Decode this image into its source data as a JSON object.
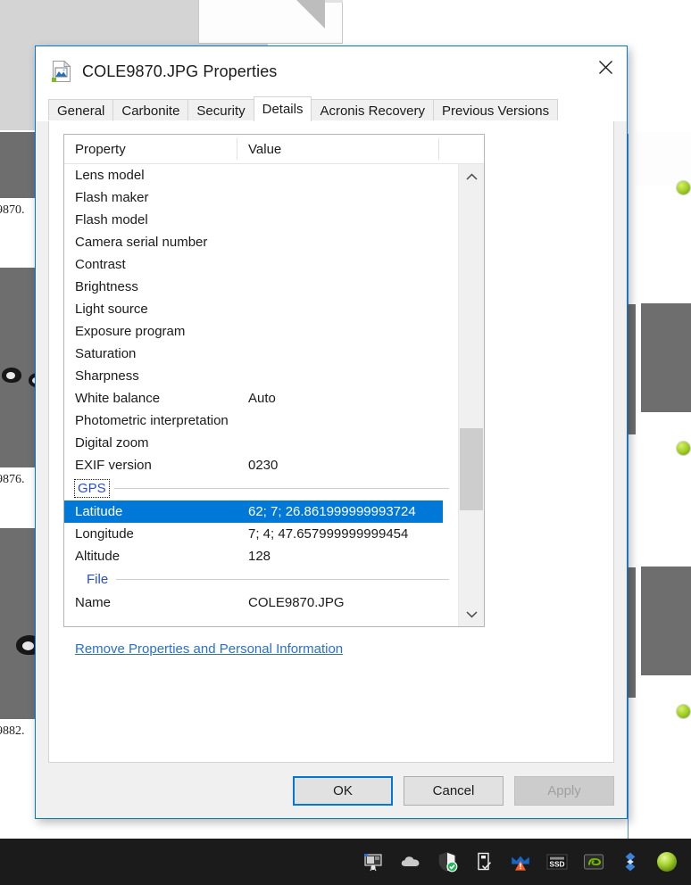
{
  "dialog": {
    "title": "COLE9870.JPG Properties",
    "title_icon": "image-file-icon",
    "close_icon": "close-icon",
    "accent_color": "#0078D7",
    "selection_color": "#0078D7",
    "link_color": "#2A6FD4",
    "section_color": "#2A4FC4"
  },
  "tabs": [
    {
      "label": "General",
      "active": false
    },
    {
      "label": "Carbonite",
      "active": false
    },
    {
      "label": "Security",
      "active": false
    },
    {
      "label": "Details",
      "active": true
    },
    {
      "label": "Acronis Recovery",
      "active": false
    },
    {
      "label": "Previous Versions",
      "active": false
    }
  ],
  "list": {
    "columns": {
      "property": "Property",
      "value": "Value"
    },
    "rows": [
      {
        "type": "item",
        "property": "Lens model",
        "value": "",
        "selected": false
      },
      {
        "type": "item",
        "property": "Flash maker",
        "value": "",
        "selected": false
      },
      {
        "type": "item",
        "property": "Flash model",
        "value": "",
        "selected": false
      },
      {
        "type": "item",
        "property": "Camera serial number",
        "value": "",
        "selected": false
      },
      {
        "type": "item",
        "property": "Contrast",
        "value": "",
        "selected": false
      },
      {
        "type": "item",
        "property": "Brightness",
        "value": "",
        "selected": false
      },
      {
        "type": "item",
        "property": "Light source",
        "value": "",
        "selected": false
      },
      {
        "type": "item",
        "property": "Exposure program",
        "value": "",
        "selected": false
      },
      {
        "type": "item",
        "property": "Saturation",
        "value": "",
        "selected": false
      },
      {
        "type": "item",
        "property": "Sharpness",
        "value": "",
        "selected": false
      },
      {
        "type": "item",
        "property": "White balance",
        "value": "Auto",
        "selected": false
      },
      {
        "type": "item",
        "property": "Photometric interpretation",
        "value": "",
        "selected": false
      },
      {
        "type": "item",
        "property": "Digital zoom",
        "value": "",
        "selected": false
      },
      {
        "type": "item",
        "property": "EXIF version",
        "value": "0230",
        "selected": false
      },
      {
        "type": "section",
        "property": "GPS",
        "value": "",
        "focused": true,
        "indented": false
      },
      {
        "type": "item",
        "property": "Latitude",
        "value": "62; 7; 26.861999999993724",
        "selected": true
      },
      {
        "type": "item",
        "property": "Longitude",
        "value": "7; 4; 47.657999999999454",
        "selected": false
      },
      {
        "type": "item",
        "property": "Altitude",
        "value": "128",
        "selected": false
      },
      {
        "type": "section",
        "property": "File",
        "value": "",
        "focused": false,
        "indented": true
      },
      {
        "type": "item",
        "property": "Name",
        "value": "COLE9870.JPG",
        "selected": false
      }
    ],
    "scrollbar": {
      "up_icon": "chevron-up-icon",
      "down_icon": "chevron-down-icon"
    }
  },
  "remove_link": {
    "label": "Remove Properties and Personal Information"
  },
  "footer": {
    "ok": "OK",
    "cancel": "Cancel",
    "apply": "Apply",
    "apply_disabled": true
  },
  "background": {
    "thumbnails": [
      {
        "caption": "9870."
      },
      {
        "caption": "9876."
      },
      {
        "caption": "9882."
      }
    ]
  },
  "taskbar": {
    "tray_icons": [
      "display-projector-icon",
      "onedrive-cloud-icon",
      "windows-defender-shield-icon",
      "usb-eject-icon",
      "malwarebytes-icon",
      "ssd-icon",
      "nvidia-icon",
      "dropbox-sync-icon",
      "green-orb-icon"
    ]
  }
}
